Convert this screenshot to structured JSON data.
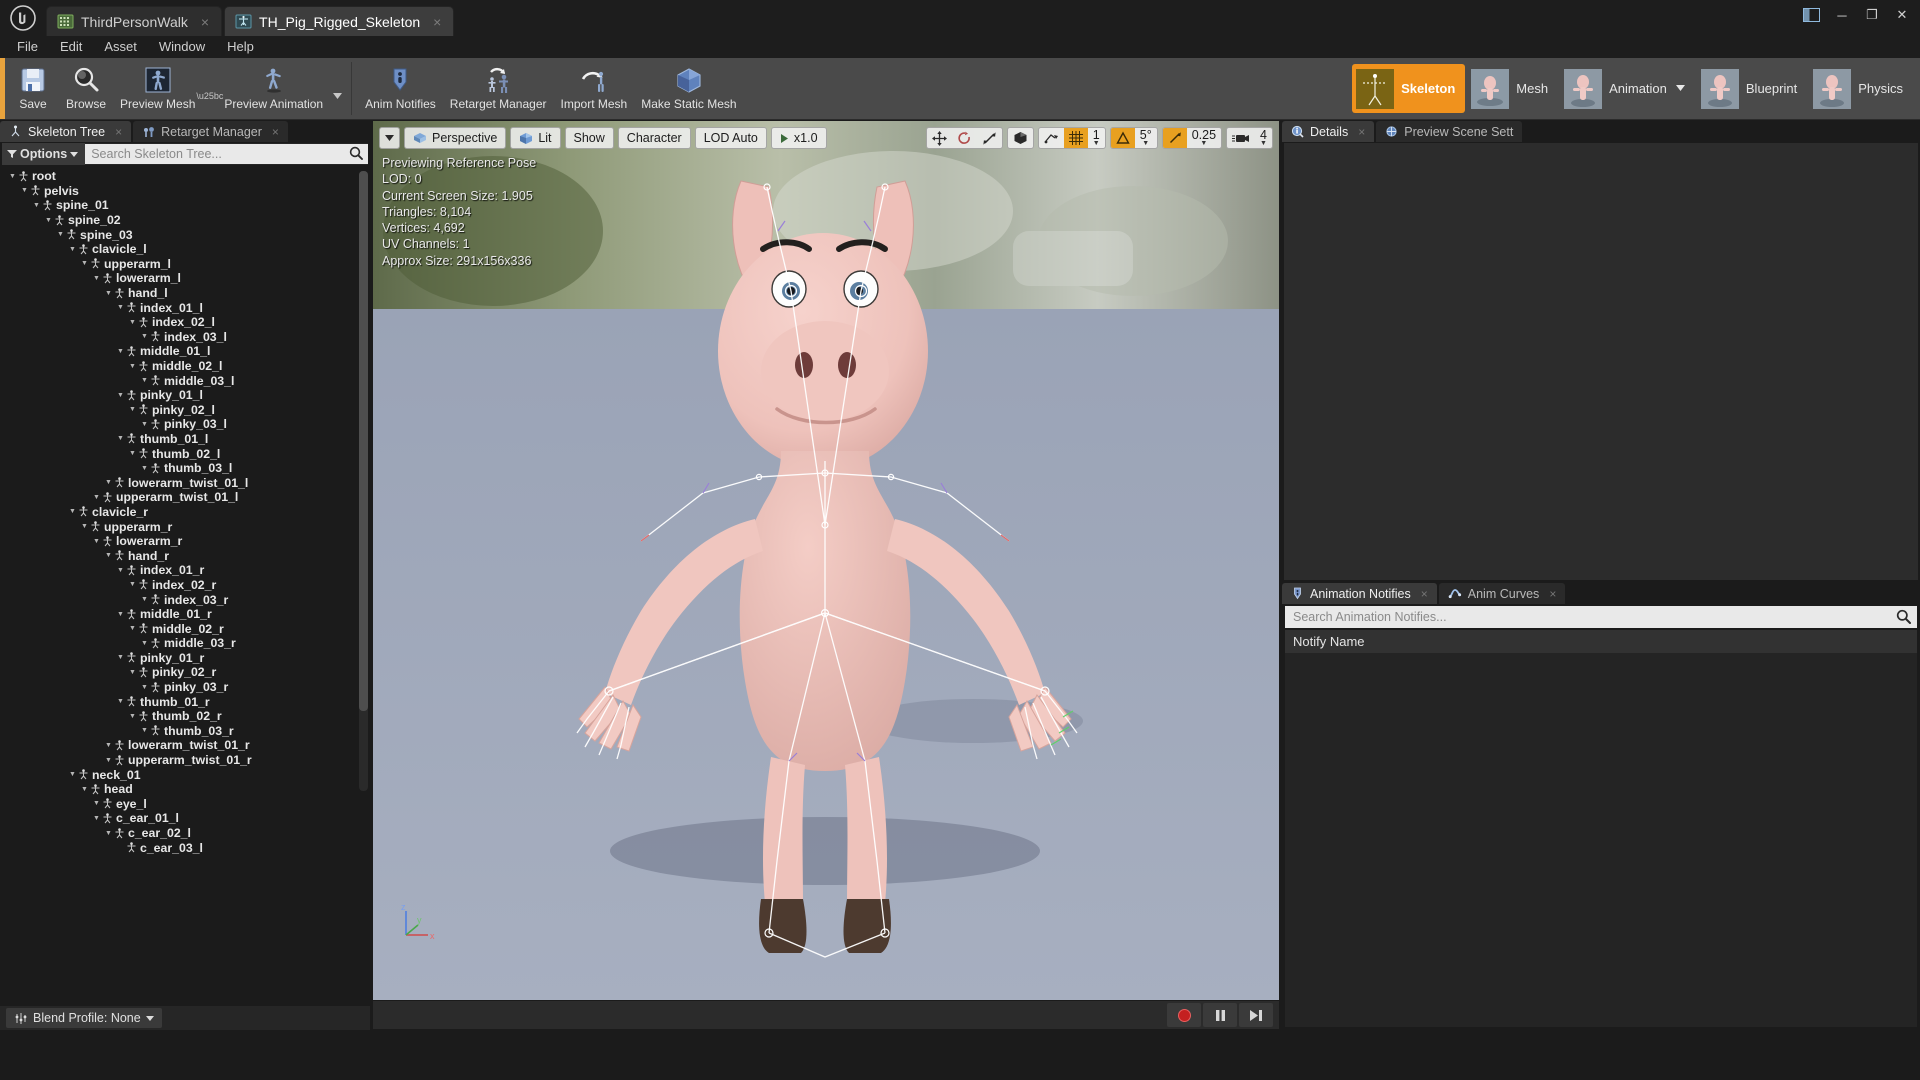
{
  "window": {
    "app": "Unreal Engine",
    "logo_glyph": "U",
    "tabs": [
      {
        "label": "ThirdPersonWalk",
        "icon": "animation-asset-icon",
        "active": false,
        "close": "×"
      },
      {
        "label": "TH_Pig_Rigged_Skeleton",
        "icon": "skeleton-asset-icon",
        "active": true,
        "close": "×"
      }
    ],
    "controls": {
      "layout": "⊞",
      "minimize": "─",
      "maximize": "❐",
      "close": "✕"
    }
  },
  "menubar": [
    "File",
    "Edit",
    "Asset",
    "Window",
    "Help"
  ],
  "toolbar": {
    "items": [
      {
        "label": "Save",
        "icon": "save-icon",
        "caret": false
      },
      {
        "label": "Browse",
        "icon": "browse-icon",
        "caret": false
      },
      {
        "label": "Preview Mesh",
        "icon": "preview-mesh-icon",
        "caret": true
      },
      {
        "label": "Preview Animation",
        "icon": "preview-animation-icon",
        "caret": true
      },
      {
        "label": "Anim Notifies",
        "icon": "anim-notifies-icon",
        "caret": false
      },
      {
        "label": "Retarget Manager",
        "icon": "retarget-manager-icon",
        "caret": false
      },
      {
        "label": "Import Mesh",
        "icon": "import-mesh-icon",
        "caret": false
      },
      {
        "label": "Make Static Mesh",
        "icon": "make-static-mesh-icon",
        "caret": false
      }
    ],
    "modes": [
      {
        "label": "Skeleton",
        "active": true,
        "caret": false
      },
      {
        "label": "Mesh",
        "active": false,
        "caret": false
      },
      {
        "label": "Animation",
        "active": false,
        "caret": true
      },
      {
        "label": "Blueprint",
        "active": false,
        "caret": false
      },
      {
        "label": "Physics",
        "active": false,
        "caret": false
      }
    ],
    "accent_color": "#f0921d"
  },
  "left_panel": {
    "tabs": [
      {
        "label": "Skeleton Tree",
        "icon": "skeleton-tree-icon",
        "active": true,
        "close": "×"
      },
      {
        "label": "Retarget Manager",
        "icon": "retarget-manager-icon",
        "active": false,
        "close": "×"
      }
    ],
    "options_label": "Options",
    "filter_glyph": "▼",
    "search_placeholder": "Search Skeleton Tree...",
    "blend_profile": "Blend Profile: None",
    "bones": [
      {
        "name": "root",
        "depth": 0
      },
      {
        "name": "pelvis",
        "depth": 1
      },
      {
        "name": "spine_01",
        "depth": 2
      },
      {
        "name": "spine_02",
        "depth": 3
      },
      {
        "name": "spine_03",
        "depth": 4
      },
      {
        "name": "clavicle_l",
        "depth": 5
      },
      {
        "name": "upperarm_l",
        "depth": 6
      },
      {
        "name": "lowerarm_l",
        "depth": 7
      },
      {
        "name": "hand_l",
        "depth": 8
      },
      {
        "name": "index_01_l",
        "depth": 9
      },
      {
        "name": "index_02_l",
        "depth": 10
      },
      {
        "name": "index_03_l",
        "depth": 11
      },
      {
        "name": "middle_01_l",
        "depth": 9
      },
      {
        "name": "middle_02_l",
        "depth": 10
      },
      {
        "name": "middle_03_l",
        "depth": 11
      },
      {
        "name": "pinky_01_l",
        "depth": 9
      },
      {
        "name": "pinky_02_l",
        "depth": 10
      },
      {
        "name": "pinky_03_l",
        "depth": 11
      },
      {
        "name": "thumb_01_l",
        "depth": 9
      },
      {
        "name": "thumb_02_l",
        "depth": 10
      },
      {
        "name": "thumb_03_l",
        "depth": 11
      },
      {
        "name": "lowerarm_twist_01_l",
        "depth": 8
      },
      {
        "name": "upperarm_twist_01_l",
        "depth": 7
      },
      {
        "name": "clavicle_r",
        "depth": 5
      },
      {
        "name": "upperarm_r",
        "depth": 6
      },
      {
        "name": "lowerarm_r",
        "depth": 7
      },
      {
        "name": "hand_r",
        "depth": 8
      },
      {
        "name": "index_01_r",
        "depth": 9
      },
      {
        "name": "index_02_r",
        "depth": 10
      },
      {
        "name": "index_03_r",
        "depth": 11
      },
      {
        "name": "middle_01_r",
        "depth": 9
      },
      {
        "name": "middle_02_r",
        "depth": 10
      },
      {
        "name": "middle_03_r",
        "depth": 11
      },
      {
        "name": "pinky_01_r",
        "depth": 9
      },
      {
        "name": "pinky_02_r",
        "depth": 10
      },
      {
        "name": "pinky_03_r",
        "depth": 11
      },
      {
        "name": "thumb_01_r",
        "depth": 9
      },
      {
        "name": "thumb_02_r",
        "depth": 10
      },
      {
        "name": "thumb_03_r",
        "depth": 11
      },
      {
        "name": "lowerarm_twist_01_r",
        "depth": 8
      },
      {
        "name": "upperarm_twist_01_r",
        "depth": 8
      },
      {
        "name": "neck_01",
        "depth": 5
      },
      {
        "name": "head",
        "depth": 6
      },
      {
        "name": "eye_l",
        "depth": 7
      },
      {
        "name": "c_ear_01_l",
        "depth": 7
      },
      {
        "name": "c_ear_02_l",
        "depth": 8
      },
      {
        "name": "c_ear_03_l",
        "depth": 9
      }
    ]
  },
  "viewport": {
    "view_menu_glyph": "▼",
    "perspective_label": "Perspective",
    "lit_label": "Lit",
    "show_label": "Show",
    "character_label": "Character",
    "lod_label": "LOD Auto",
    "playrate_label": "x1.0",
    "play_glyph": "▶",
    "transform_tools": [
      "translate-icon",
      "rotate-icon",
      "scale-icon"
    ],
    "coord_space": "world-space-icon",
    "grid_snap_value": "1",
    "rotation_snap_value": "5°",
    "scale_snap_value": "0.25",
    "camera_speed_value": "4",
    "stats": [
      "Previewing Reference Pose",
      "LOD: 0",
      "Current Screen Size: 1.905",
      "Triangles: 8,104",
      "Vertices: 4,692",
      "UV Channels: 1",
      "Approx Size: 291x156x336"
    ],
    "axis_labels": {
      "x": "x",
      "y": "y",
      "z": "z"
    },
    "transport": [
      {
        "name": "record-button",
        "glyph": "●",
        "color": "#cf2020"
      },
      {
        "name": "pause-button",
        "glyph": "❙❙",
        "color": "#d8d8d8"
      },
      {
        "name": "step-forward-button",
        "glyph": "▶❙",
        "color": "#d8d8d8"
      }
    ]
  },
  "right_panel": {
    "top_tabs": [
      {
        "label": "Details",
        "icon": "details-icon",
        "active": true,
        "close": "×"
      },
      {
        "label": "Preview Scene Sett",
        "icon": "preview-scene-icon",
        "active": false,
        "close": ""
      }
    ],
    "bottom_tabs": [
      {
        "label": "Animation Notifies",
        "icon": "anim-notifies-icon",
        "active": true,
        "close": "×"
      },
      {
        "label": "Anim Curves",
        "icon": "anim-curves-icon",
        "active": false,
        "close": "×"
      }
    ],
    "notifies_search_placeholder": "Search Animation Notifies...",
    "notifies_column": "Notify Name"
  }
}
